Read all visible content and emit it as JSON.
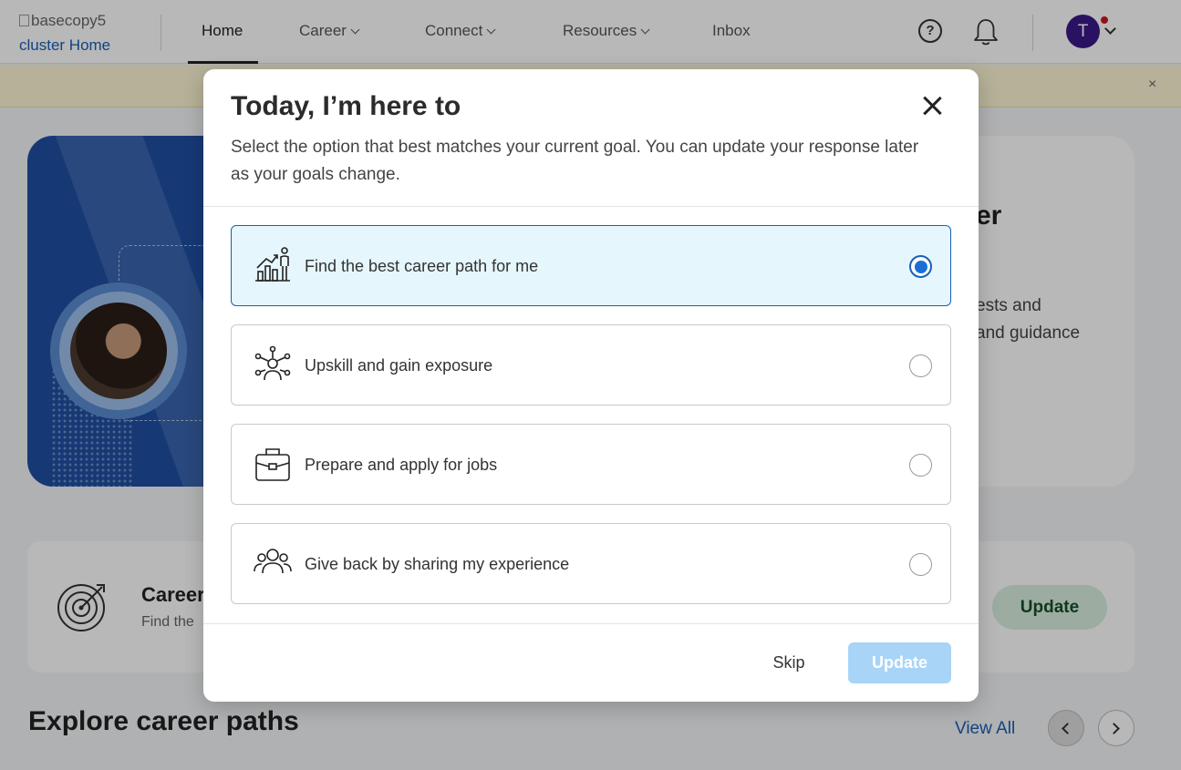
{
  "nav": {
    "logo_alt": "basecopy5",
    "logo_text": "cluster Home",
    "items": [
      {
        "label": "Home"
      },
      {
        "label": "Career"
      },
      {
        "label": "Connect"
      },
      {
        "label": "Resources"
      },
      {
        "label": "Inbox"
      }
    ],
    "avatar_initial": "T"
  },
  "banner": {
    "close_glyph": "×"
  },
  "hero": {
    "title_fragment": "er",
    "text_line1": "ests and",
    "text_line2": "and guidance"
  },
  "goal_card": {
    "title_fragment": "Career",
    "sub_fragment": "Find the",
    "update_label": "Update"
  },
  "explore": {
    "title": "Explore career paths",
    "view_all": "View All"
  },
  "modal": {
    "title": "Today, I’m here to",
    "subtitle": "Select the option that best matches your current goal. You can update your response later as your goals change.",
    "options": [
      {
        "label": "Find the best career path for me",
        "icon": "career-growth-icon",
        "selected": true
      },
      {
        "label": "Upskill and gain exposure",
        "icon": "network-icon",
        "selected": false
      },
      {
        "label": "Prepare and apply for jobs",
        "icon": "briefcase-icon",
        "selected": false
      },
      {
        "label": "Give back by sharing my experience",
        "icon": "community-icon",
        "selected": false
      }
    ],
    "skip_label": "Skip",
    "update_label": "Update",
    "colors": {
      "accent": "#1a6fd6",
      "selected_bg": "#e5f6fd",
      "update_disabled": "#a8d4f7"
    }
  }
}
